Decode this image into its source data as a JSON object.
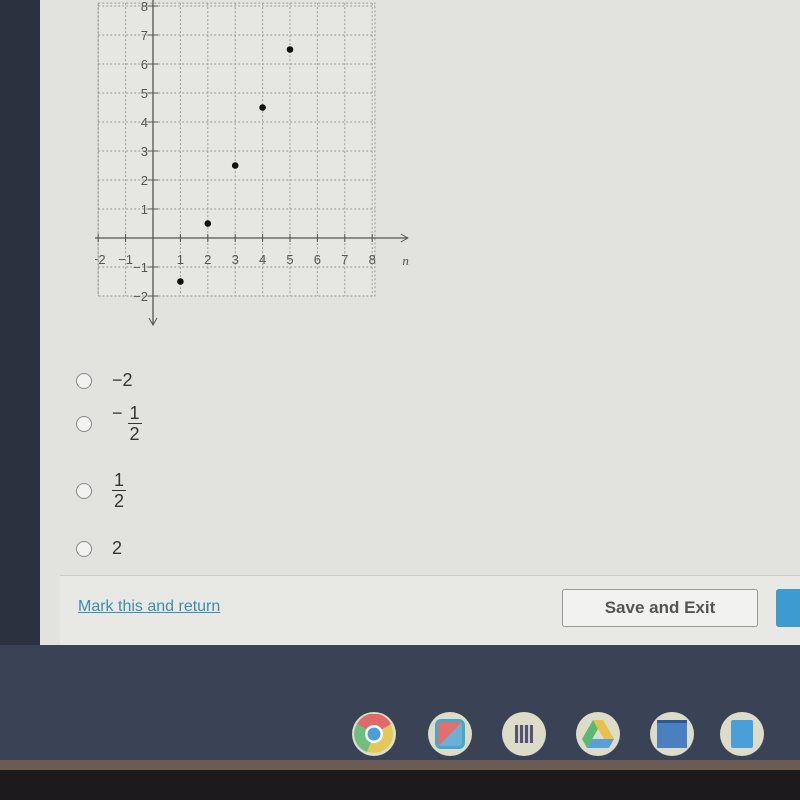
{
  "chart_data": {
    "type": "scatter",
    "xlabel": "n",
    "x_ticks": [
      -2,
      -1,
      1,
      2,
      3,
      4,
      5,
      6,
      7,
      8
    ],
    "y_ticks": [
      -2,
      -1,
      1,
      2,
      3,
      4,
      5,
      6,
      7,
      8
    ],
    "xlim": [
      -2,
      8
    ],
    "ylim": [
      -2,
      8
    ],
    "grid": true,
    "points": [
      {
        "x": 1,
        "y": -1.5
      },
      {
        "x": 2,
        "y": 0.5
      },
      {
        "x": 3,
        "y": 2.5
      },
      {
        "x": 4,
        "y": 4.5
      },
      {
        "x": 5,
        "y": 6.5
      }
    ]
  },
  "options": [
    {
      "label": "−2"
    },
    {
      "sign": "−",
      "num": "1",
      "den": "2"
    },
    {
      "num": "1",
      "den": "2"
    },
    {
      "label": "2"
    }
  ],
  "footer": {
    "mark": "Mark this and return",
    "save": "Save and Exit"
  },
  "taskbar": [
    "chrome-icon",
    "screencastify-icon",
    "qr-code-icon",
    "google-drive-icon",
    "window-app-icon",
    "google-docs-icon"
  ]
}
